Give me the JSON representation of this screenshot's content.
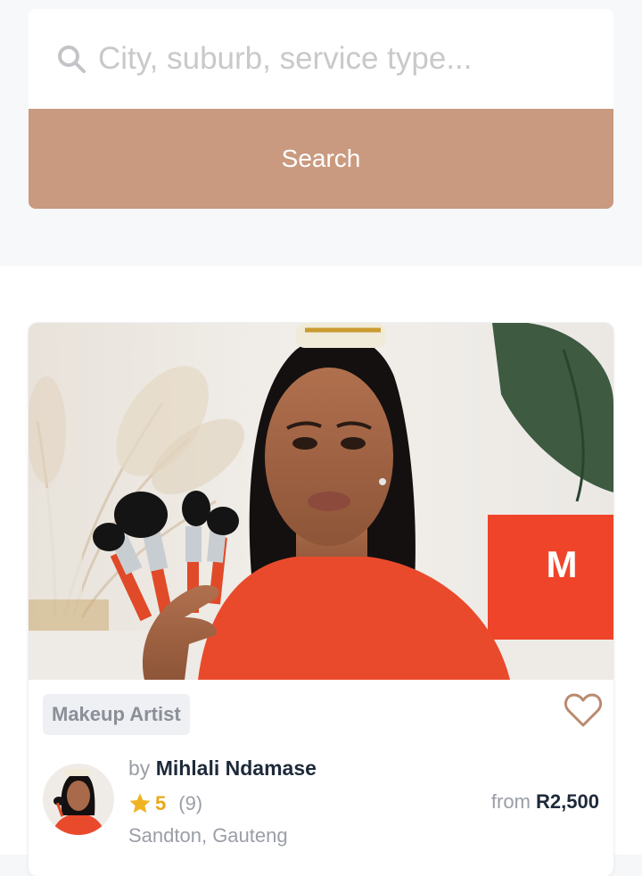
{
  "search": {
    "placeholder": "City, suburb, service type...",
    "button_label": "Search",
    "button_color": "#c99a7f"
  },
  "listing": {
    "category": "Makeup Artist",
    "by_prefix": "by",
    "artist_name": "Mihlali Ndamase",
    "rating": "5",
    "review_count": "(9)",
    "location": "Sandton, Gauteng",
    "price_prefix": "from",
    "price": "R2,500",
    "icons": {
      "favorite": "heart-outline-icon",
      "rating": "star-icon"
    },
    "colors": {
      "heart": "#b98a6e",
      "star": "#f0b323",
      "shirt": "#ea4a2c",
      "brand_box": "#f0442a"
    },
    "image_logo_text": "M"
  }
}
